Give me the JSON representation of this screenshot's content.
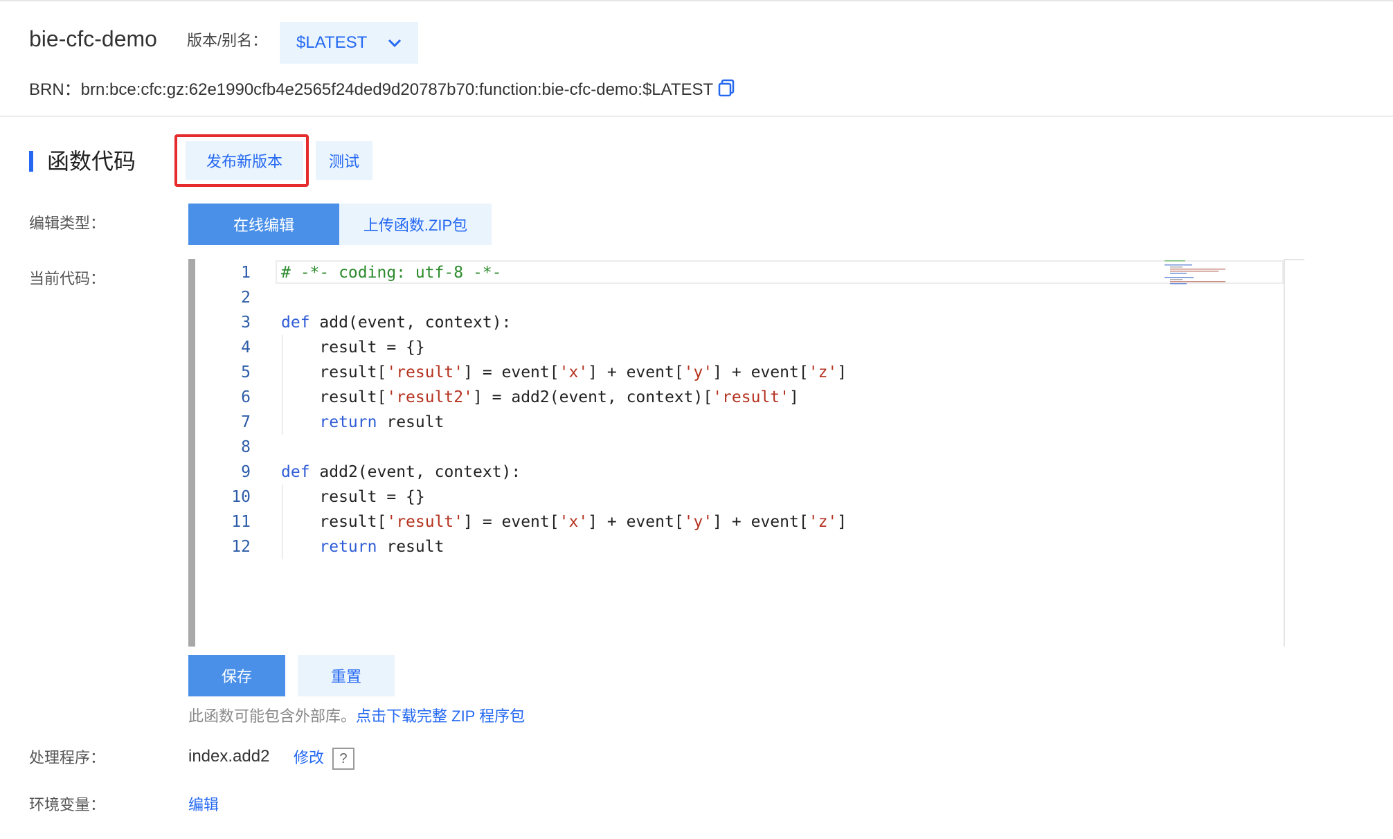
{
  "header": {
    "function_name": "bie-cfc-demo",
    "version_label": "版本/别名：",
    "version_value": "$LATEST",
    "brn_label": "BRN：",
    "brn_value": "brn:bce:cfc:gz:62e1990cfb4e2565f24ded9d20787b70:function:bie-cfc-demo:$LATEST",
    "copy_icon": "copy-icon"
  },
  "section": {
    "title": "函数代码",
    "publish_label": "发布新版本",
    "test_label": "测试"
  },
  "edit_type": {
    "label": "编辑类型：",
    "tabs": [
      "在线编辑",
      "上传函数.ZIP包"
    ],
    "active": 0
  },
  "current_code": {
    "label": "当前代码：",
    "line_numbers": [
      "1",
      "2",
      "3",
      "4",
      "5",
      "6",
      "7",
      "8",
      "9",
      "10",
      "11",
      "12"
    ],
    "lines": [
      "# -*- coding: utf-8 -*-",
      "",
      "def add(event, context):",
      "    result = {}",
      "    result['result'] = event['x'] + event['y'] + event['z']",
      "    result['result2'] = add2(event, context)['result']",
      "    return result",
      "",
      "def add2(event, context):",
      "    result = {}",
      "    result['result'] = event['x'] + event['y'] + event['z']",
      "    return result"
    ]
  },
  "actions": {
    "save_label": "保存",
    "reset_label": "重置"
  },
  "zip_note": {
    "text": "此函数可能包含外部库。",
    "link": "点击下载完整 ZIP 程序包"
  },
  "handler": {
    "label": "处理程序：",
    "value": "index.add2",
    "edit_link": "修改",
    "help": "?"
  },
  "env": {
    "label": "环境变量：",
    "edit_link": "编辑"
  },
  "colors": {
    "accent": "#2468f2",
    "primary_button": "#4a90e8",
    "light_button": "#eaf4fd",
    "highlight_border": "#e52b2b"
  }
}
